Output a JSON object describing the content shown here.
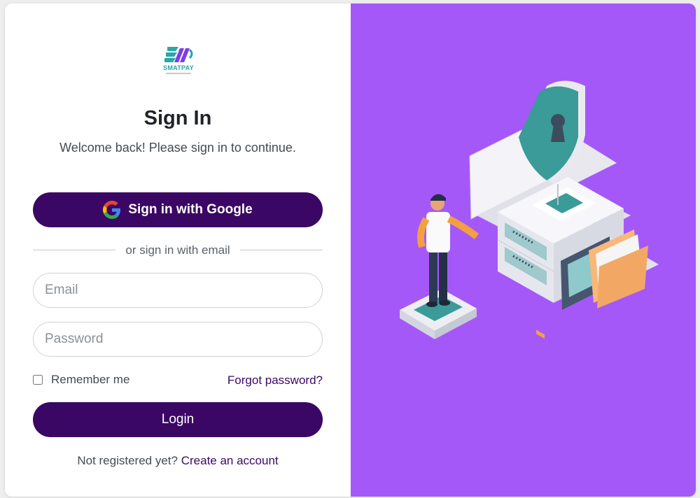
{
  "brand": {
    "logo_text": "SMATPAY",
    "colors": {
      "teal": "#2aa6a8",
      "purple": "#7b3fe4",
      "panel": "#a558f8",
      "primary": "#3b0764"
    }
  },
  "login": {
    "title": "Sign In",
    "subtitle": "Welcome back! Please sign in to continue.",
    "google_button_label": "Sign in with Google",
    "google_icon": "google-g-icon",
    "divider_text": "or sign in with email",
    "email_placeholder": "Email",
    "password_placeholder": "Password",
    "remember_label": "Remember me",
    "remember_checked": false,
    "forgot_label": "Forgot password?",
    "login_button_label": "Login",
    "register_prompt": "Not registered yet?",
    "register_link": "Create an account"
  },
  "illustration": {
    "name": "security-server-illustration"
  }
}
